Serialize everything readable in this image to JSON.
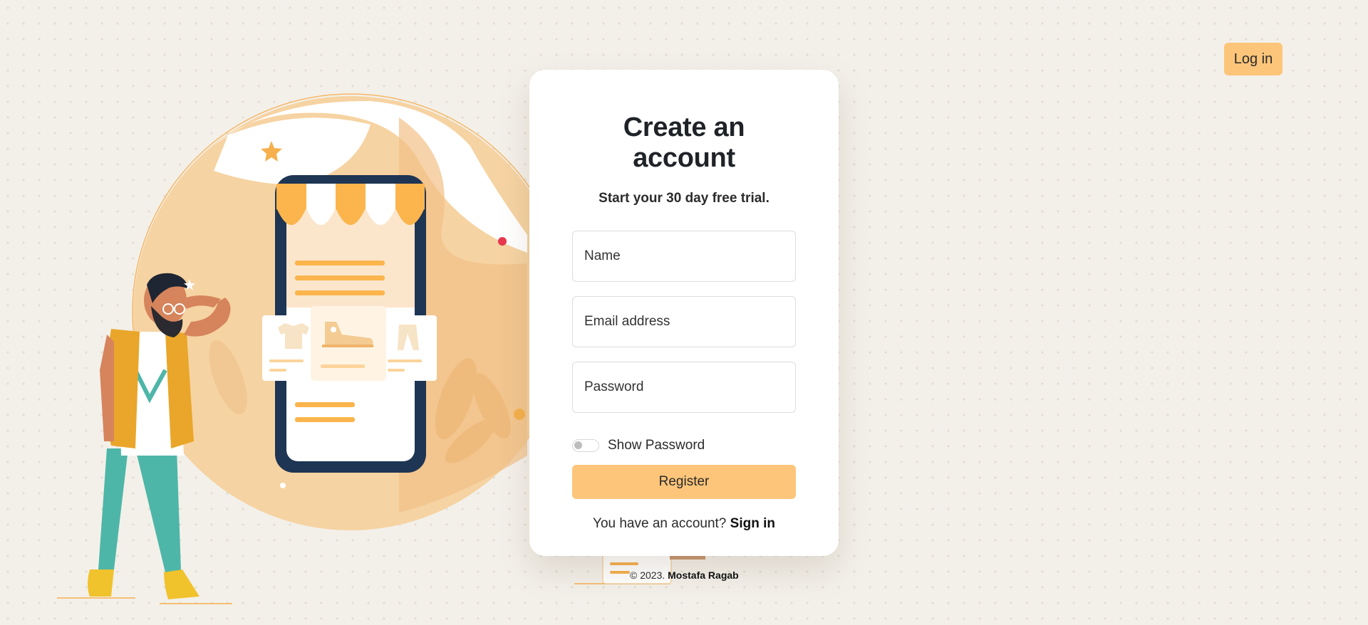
{
  "header": {
    "login_label": "Log in"
  },
  "form": {
    "title": "Create an account",
    "subtitle": "Start your 30 day free trial.",
    "name_placeholder": "Name",
    "email_placeholder": "Email address",
    "password_placeholder": "Password",
    "show_password_label": "Show Password",
    "show_password_on": false,
    "register_label": "Register",
    "have_account_text": "You have an account?",
    "sign_in_label": "Sign in"
  },
  "footer": {
    "copyright": "© 2023.",
    "author": "Mostafa Ragab"
  },
  "colors": {
    "accent": "#fcc57a",
    "accent_dark": "#fbb54c",
    "phone_frame": "#1e3553",
    "background": "#f3f0ea"
  },
  "icons": [
    "shop-awning-icon",
    "shirt-icon",
    "sneaker-icon",
    "pants-icon",
    "star-icon"
  ]
}
